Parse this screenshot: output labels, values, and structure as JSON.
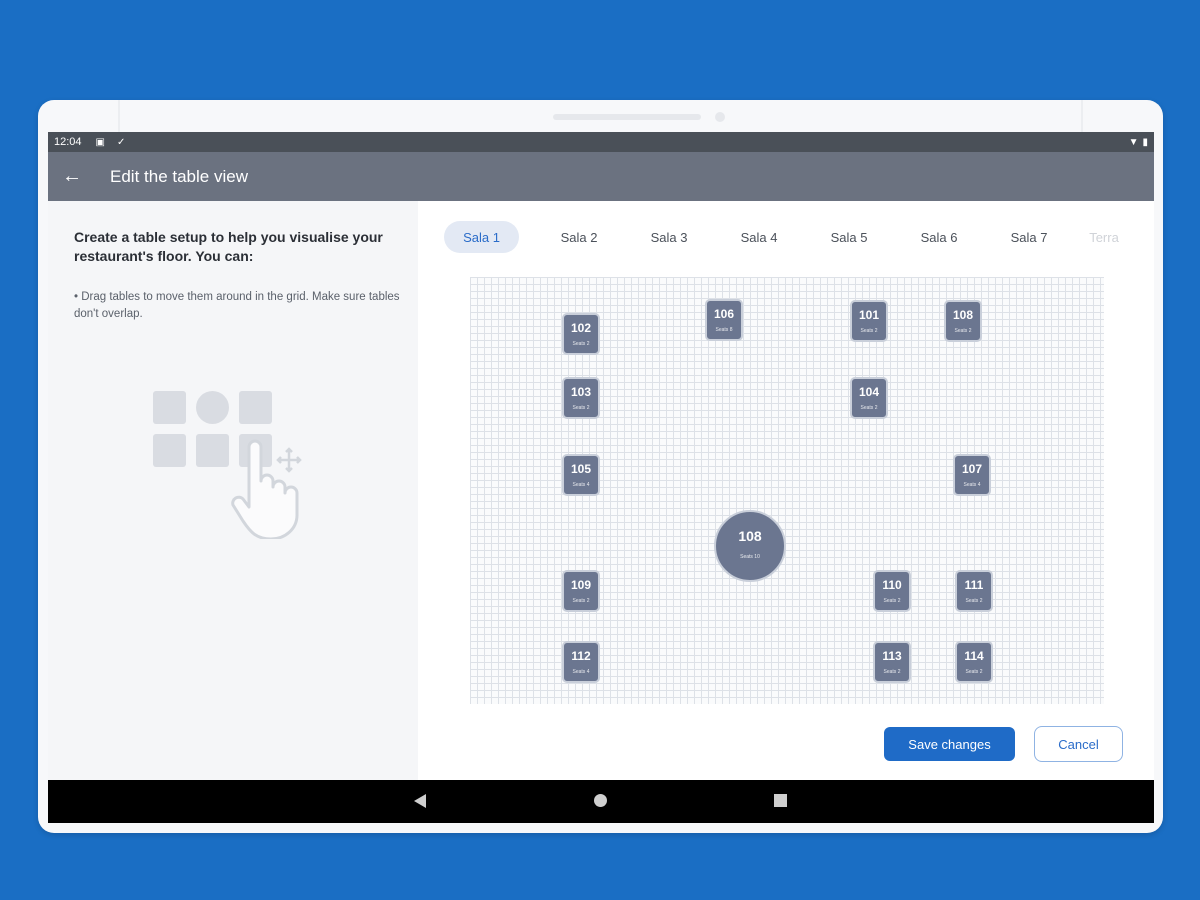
{
  "status_bar": {
    "time": "12:04",
    "icons": [
      "image-icon",
      "check-icon",
      "wifi-icon",
      "battery-icon"
    ]
  },
  "app_bar": {
    "title": "Edit the table view",
    "back_icon": "arrow-left-icon"
  },
  "left_pane": {
    "heading": "Create a table setup to help you visualise your restaurant's floor. You can:",
    "bullet": "• Drag tables to move them around in the grid. Make sure tables don't overlap.",
    "illustration_icon": "drag-tables-illustration"
  },
  "tabs": [
    {
      "label": "Sala 1",
      "active": true
    },
    {
      "label": "Sala 2"
    },
    {
      "label": "Sala 3"
    },
    {
      "label": "Sala 4"
    },
    {
      "label": "Sala 5"
    },
    {
      "label": "Sala 6"
    },
    {
      "label": "Sala 7"
    },
    {
      "label": "Terra"
    }
  ],
  "tables": [
    {
      "number": "102",
      "seats": "Seats 2"
    },
    {
      "number": "106",
      "seats": "Seats 8"
    },
    {
      "number": "101",
      "seats": "Seats 2"
    },
    {
      "number": "108",
      "seats": "Seats 2"
    },
    {
      "number": "103",
      "seats": "Seats 2"
    },
    {
      "number": "104",
      "seats": "Seats 2"
    },
    {
      "number": "105",
      "seats": "Seats 4"
    },
    {
      "number": "107",
      "seats": "Seats 4"
    },
    {
      "number": "108",
      "seats": "Seats 10"
    },
    {
      "number": "109",
      "seats": "Seats 2"
    },
    {
      "number": "110",
      "seats": "Seats 2"
    },
    {
      "number": "111",
      "seats": "Seats 2"
    },
    {
      "number": "112",
      "seats": "Seats 4"
    },
    {
      "number": "113",
      "seats": "Seats 2"
    },
    {
      "number": "114",
      "seats": "Seats 2"
    }
  ],
  "actions": {
    "save_label": "Save changes",
    "cancel_label": "Cancel"
  },
  "colors": {
    "accent": "#1f6bc7",
    "table": "#6b7690",
    "app_bar": "#6b7280",
    "background": "#1a6ec4"
  }
}
